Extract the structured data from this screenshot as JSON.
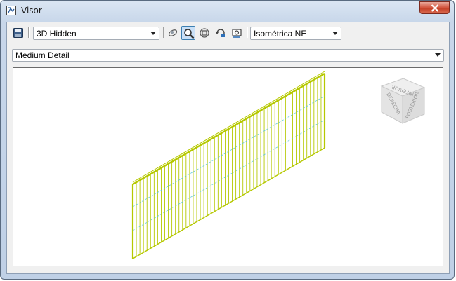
{
  "window": {
    "title": "Visor",
    "close_icon": "close-icon"
  },
  "toolbar": {
    "save_icon": "save-icon",
    "view_style": "3D Hidden",
    "tools": [
      "orbit-icon",
      "zoom-icon",
      "zoom-extents-icon",
      "rotate-icon",
      "camera-icon"
    ],
    "active_tool": "zoom-icon",
    "view_direction": "Isométrica NE"
  },
  "detail_level": "Medium Detail",
  "viewcube": {
    "faces": [
      "INFERIOR",
      "DERECHA",
      "POSTERIOR"
    ]
  },
  "colors": {
    "model": "#b5c800",
    "cut_lines": "#56c6d8"
  }
}
